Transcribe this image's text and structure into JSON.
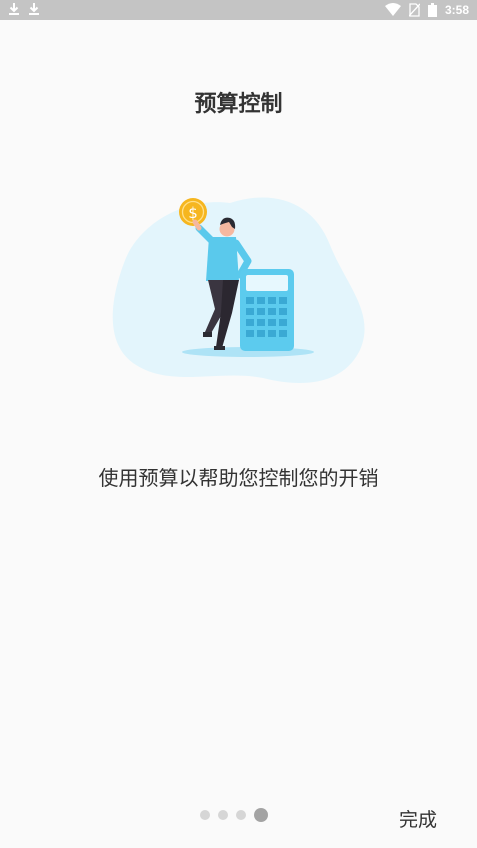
{
  "status_bar": {
    "time": "3:58",
    "left_icons": [
      "download-icon",
      "download-icon"
    ],
    "right_icons": [
      "wifi-icon",
      "no-sim-icon",
      "battery-icon"
    ]
  },
  "onboarding": {
    "title": "预算控制",
    "caption": "使用预算以帮助您控制您的开销",
    "page_count": 4,
    "current_page": 4,
    "done_label": "完成",
    "illustration_icon": "person-coin-calculator-illustration",
    "coin_symbol": "$"
  },
  "colors": {
    "background": "#fafafa",
    "status_bar": "#c4c4c4",
    "blob": "#e3f5fc",
    "calculator": "#5ccbee",
    "coin": "#f6b61f",
    "dot_inactive": "#d6d6d6",
    "dot_active": "#a3a3a3"
  }
}
